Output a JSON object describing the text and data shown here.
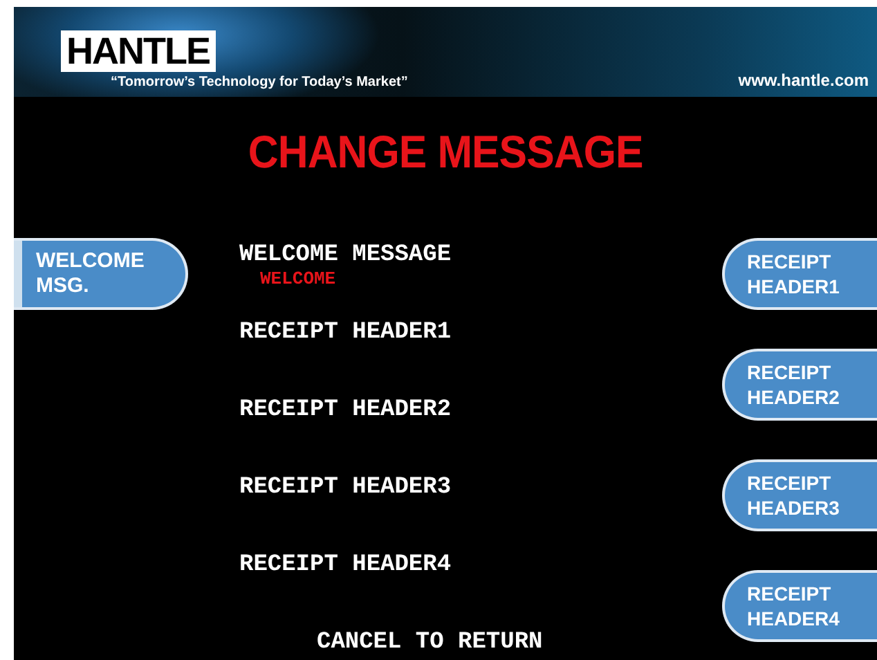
{
  "header": {
    "logo": "HANTLE",
    "tagline": "“Tomorrow’s Technology for Today’s Market”",
    "url": "www.hantle.com"
  },
  "title": "CHANGE MESSAGE",
  "left_buttons": [
    {
      "label": "WELCOME MSG."
    }
  ],
  "menu": [
    {
      "label": "WELCOME MESSAGE",
      "value": "WELCOME"
    },
    {
      "label": "RECEIPT HEADER1"
    },
    {
      "label": "RECEIPT HEADER2"
    },
    {
      "label": "RECEIPT HEADER3"
    },
    {
      "label": "RECEIPT HEADER4"
    }
  ],
  "footer": "CANCEL TO RETURN",
  "right_buttons": [
    {
      "label": "RECEIPT HEADER1"
    },
    {
      "label": "RECEIPT HEADER2"
    },
    {
      "label": "RECEIPT HEADER3"
    },
    {
      "label": "RECEIPT HEADER4"
    }
  ]
}
